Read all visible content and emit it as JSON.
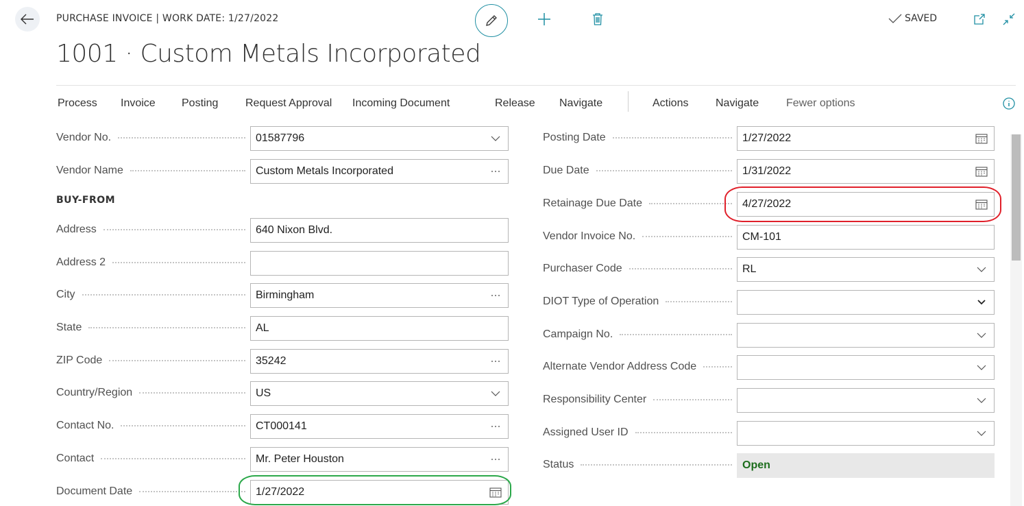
{
  "header": {
    "breadcrumb": "PURCHASE INVOICE | WORK DATE: 1/27/2022",
    "saved_label": "SAVED",
    "title": "1001 · Custom Metals Incorporated"
  },
  "actions": {
    "items": [
      "Process",
      "Invoice",
      "Posting",
      "Request Approval",
      "Incoming Document",
      "Release",
      "Navigate",
      "Actions",
      "Navigate",
      "Fewer options"
    ]
  },
  "left": {
    "section_head": "BUY-FROM",
    "fields": [
      {
        "label": "Vendor No.",
        "value": "01587796",
        "icon": "chevron-down-icon"
      },
      {
        "label": "Vendor Name",
        "value": "Custom Metals Incorporated",
        "icon": "ellipsis-icon"
      },
      {
        "label": "Address",
        "value": "640 Nixon Blvd.",
        "icon": ""
      },
      {
        "label": "Address 2",
        "value": "",
        "icon": ""
      },
      {
        "label": "City",
        "value": "Birmingham",
        "icon": "ellipsis-icon"
      },
      {
        "label": "State",
        "value": "AL",
        "icon": ""
      },
      {
        "label": "ZIP Code",
        "value": "35242",
        "icon": "ellipsis-icon"
      },
      {
        "label": "Country/Region",
        "value": "US",
        "icon": "chevron-down-icon"
      },
      {
        "label": "Contact No.",
        "value": "CT000141",
        "icon": "ellipsis-icon"
      },
      {
        "label": "Contact",
        "value": "Mr. Peter Houston",
        "icon": "ellipsis-icon"
      },
      {
        "label": "Document Date",
        "value": "1/27/2022",
        "icon": "calendar-icon"
      }
    ]
  },
  "right": {
    "fields": [
      {
        "label": "Posting Date",
        "value": "1/27/2022",
        "icon": "calendar-icon"
      },
      {
        "label": "Due Date",
        "value": "1/31/2022",
        "icon": "calendar-icon"
      },
      {
        "label": "Retainage Due Date",
        "value": "4/27/2022",
        "icon": "calendar-icon"
      },
      {
        "label": "Vendor Invoice No.",
        "value": "CM-101",
        "icon": ""
      },
      {
        "label": "Purchaser Code",
        "value": "RL",
        "icon": "chevron-down-icon"
      },
      {
        "label": "DIOT Type of Operation",
        "value": "",
        "icon": "select-arrow-icon"
      },
      {
        "label": "Campaign No.",
        "value": "",
        "icon": "chevron-down-icon"
      },
      {
        "label": "Alternate Vendor Address Code",
        "value": "",
        "icon": "chevron-down-icon"
      },
      {
        "label": "Responsibility Center",
        "value": "",
        "icon": "chevron-down-icon"
      },
      {
        "label": "Assigned User ID",
        "value": "",
        "icon": "chevron-down-icon"
      },
      {
        "label": "Status",
        "value": "Open",
        "icon": ""
      }
    ]
  },
  "colors": {
    "accent": "#1f8fa3",
    "highlight_red": "#e0202a",
    "highlight_green": "#2ba84a",
    "status_open": "#1d6e1d"
  },
  "icons": [
    "back-arrow-icon",
    "pencil-icon",
    "plus-icon",
    "trash-icon",
    "check-icon",
    "popout-icon",
    "collapse-icon",
    "info-icon"
  ]
}
